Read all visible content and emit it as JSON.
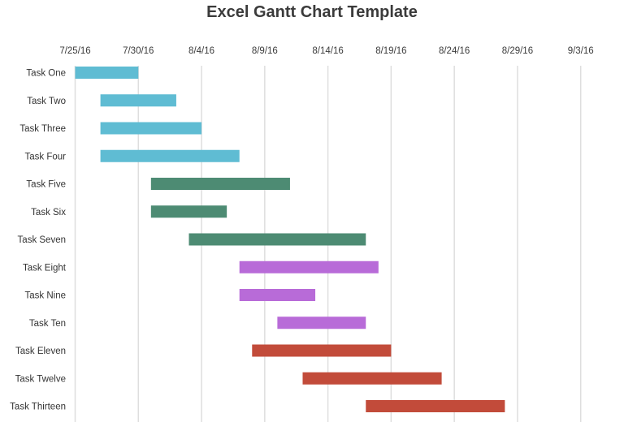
{
  "chart_data": {
    "type": "bar",
    "subtype": "gantt",
    "orientation": "horizontal",
    "title": "Excel Gantt Chart Template",
    "xlabel": "",
    "ylabel": "",
    "grid": true,
    "legend": "none",
    "x_axis": {
      "min": "7/25/16",
      "max": "9/3/16",
      "major_unit_days": 5,
      "ticks": [
        "7/25/16",
        "7/30/16",
        "8/4/16",
        "8/9/16",
        "8/14/16",
        "8/19/16",
        "8/24/16",
        "8/29/16",
        "9/3/16"
      ]
    },
    "tasks": [
      {
        "name": "Task One",
        "start": "7/25/16",
        "duration_days": 5,
        "color": "#5fbcd3"
      },
      {
        "name": "Task Two",
        "start": "7/27/16",
        "duration_days": 6,
        "color": "#5fbcd3"
      },
      {
        "name": "Task Three",
        "start": "7/27/16",
        "duration_days": 8,
        "color": "#5fbcd3"
      },
      {
        "name": "Task Four",
        "start": "7/27/16",
        "duration_days": 11,
        "color": "#5fbcd3"
      },
      {
        "name": "Task Five",
        "start": "7/31/16",
        "duration_days": 11,
        "color": "#4d8b73"
      },
      {
        "name": "Task Six",
        "start": "7/31/16",
        "duration_days": 6,
        "color": "#4d8b73"
      },
      {
        "name": "Task Seven",
        "start": "8/3/16",
        "duration_days": 14,
        "color": "#4d8b73"
      },
      {
        "name": "Task Eight",
        "start": "8/7/16",
        "duration_days": 11,
        "color": "#b86bd8"
      },
      {
        "name": "Task Nine",
        "start": "8/7/16",
        "duration_days": 6,
        "color": "#b86bd8"
      },
      {
        "name": "Task Ten",
        "start": "8/10/16",
        "duration_days": 7,
        "color": "#b86bd8"
      },
      {
        "name": "Task Eleven",
        "start": "8/8/16",
        "duration_days": 11,
        "color": "#c24b3a"
      },
      {
        "name": "Task Twelve",
        "start": "8/12/16",
        "duration_days": 11,
        "color": "#c24b3a"
      },
      {
        "name": "Task Thirteen",
        "start": "8/17/16",
        "duration_days": 11,
        "color": "#c24b3a"
      }
    ]
  }
}
